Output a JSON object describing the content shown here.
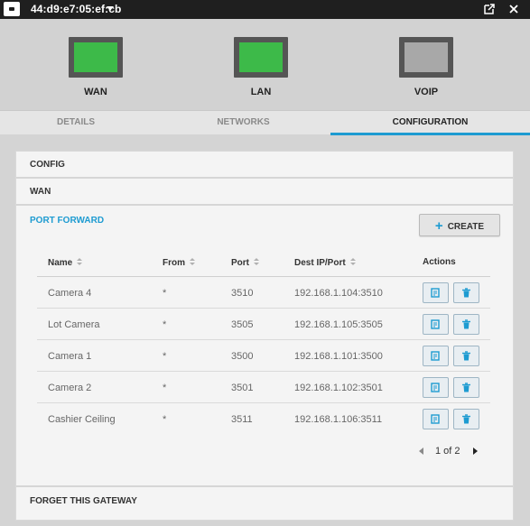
{
  "titlebar": {
    "device_name": "44:d9:e7:05:ef:cb"
  },
  "ports": [
    {
      "label": "WAN",
      "status": "up"
    },
    {
      "label": "LAN",
      "status": "up"
    },
    {
      "label": "VOIP",
      "status": "down"
    }
  ],
  "tabs": [
    {
      "label": "DETAILS"
    },
    {
      "label": "NETWORKS"
    },
    {
      "label": "CONFIGURATION",
      "active": true
    }
  ],
  "sections": {
    "config": "CONFIG",
    "wan": "WAN",
    "port_forward": "PORT FORWARD",
    "forget": "FORGET THIS GATEWAY"
  },
  "create_button": {
    "label": "CREATE"
  },
  "table": {
    "columns": [
      "Name",
      "From",
      "Port",
      "Dest IP/Port",
      "Actions"
    ],
    "rows": [
      {
        "name": "Camera 4",
        "from": "*",
        "port": "3510",
        "dest": "192.168.1.104:3510"
      },
      {
        "name": "Lot Camera",
        "from": "*",
        "port": "3505",
        "dest": "192.168.1.105:3505"
      },
      {
        "name": "Camera 1",
        "from": "*",
        "port": "3500",
        "dest": "192.168.1.101:3500"
      },
      {
        "name": "Camera 2",
        "from": "*",
        "port": "3501",
        "dest": "192.168.1.102:3501"
      },
      {
        "name": "Cashier Ceiling",
        "from": "*",
        "port": "3511",
        "dest": "192.168.1.106:3511"
      }
    ]
  },
  "pagination": {
    "text": "1 of 2"
  },
  "colors": {
    "accent": "#1d9bd1",
    "port_up": "#3dba49",
    "port_down": "#a8a8a8",
    "titlebar": "#1f1f1f"
  },
  "icons": [
    "device-icon",
    "dropdown-caret-icon",
    "popout-icon",
    "close-icon",
    "plus-icon",
    "sort-icon",
    "edit-icon",
    "trash-icon",
    "prev-page-icon",
    "next-page-icon"
  ]
}
